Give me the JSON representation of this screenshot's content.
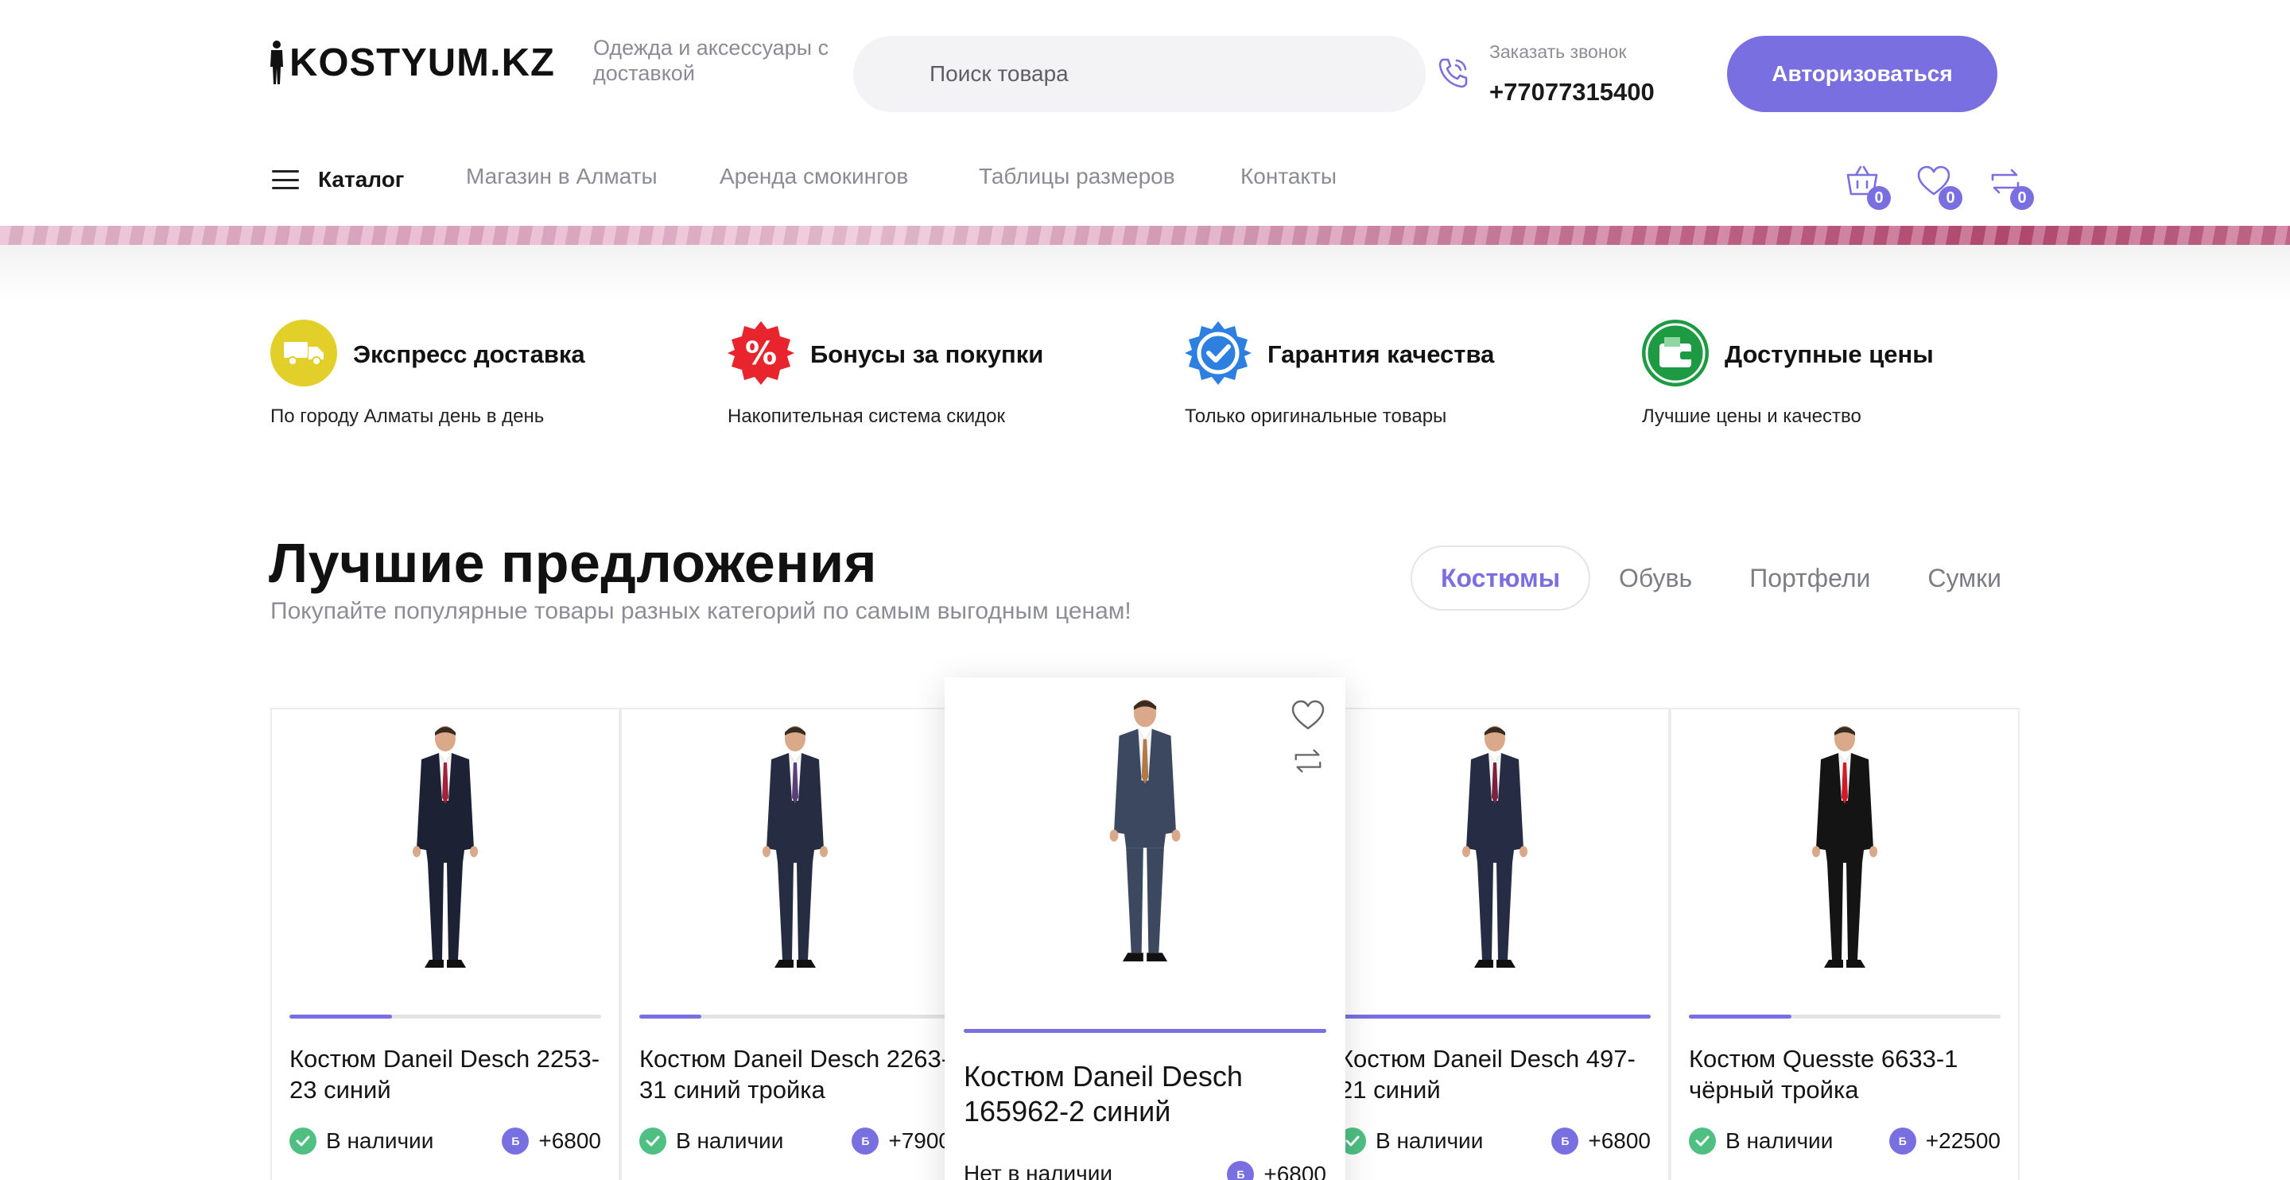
{
  "header": {
    "logo_text": "KOSTYUM.KZ",
    "tagline": "Одежда и аксессуары с доставкой",
    "search_placeholder": "Поиск товара",
    "callback_label": "Заказать звонок",
    "phone": "+77077315400",
    "login_label": "Авторизоваться"
  },
  "nav": {
    "catalog_label": "Каталог",
    "links": [
      "Магазин в Алматы",
      "Аренда смокингов",
      "Таблицы размеров",
      "Контакты"
    ],
    "cart_count": "0",
    "favorites_count": "0",
    "compare_count": "0"
  },
  "features": [
    {
      "title": "Экспресс доставка",
      "desc": "По городу Алматы день в день",
      "icon": "delivery-truck-icon",
      "color": "#e2cf2a"
    },
    {
      "title": "Бонусы за покупки",
      "desc": "Накопительная система скидок",
      "icon": "percent-badge-icon",
      "color": "#e8242c"
    },
    {
      "title": "Гарантия качества",
      "desc": "Только оригинальные товары",
      "icon": "quality-check-icon",
      "color": "#2d7fe0"
    },
    {
      "title": "Доступные цены",
      "desc": "Лучшие цены и качество",
      "icon": "wallet-icon",
      "color": "#1e9a43"
    }
  ],
  "offers": {
    "title": "Лучшие предложения",
    "subtitle": "Покупайте популярные товары разных категорий по самым выгодным ценам!",
    "tabs": [
      "Костюмы",
      "Обувь",
      "Портфели",
      "Сумки"
    ],
    "active_tab": "Костюмы"
  },
  "bonus_badge_letter": "Б",
  "products": [
    {
      "name": "Костюм Daneil Desch 2253-23 синий",
      "stock": "В наличии",
      "bonus": "+6800",
      "in_stock": true,
      "suit_color": "#1c2233",
      "tie_color": "#a3223a",
      "image_progress": 0.33
    },
    {
      "name": "Костюм Daneil Desch 2263-31 синий тройка",
      "stock": "В наличии",
      "bonus": "+7900",
      "in_stock": true,
      "suit_color": "#262d42",
      "tie_color": "#5a3f7a",
      "image_progress": 0.2
    },
    {
      "name": "Костюм Daneil Desch 165962-2 синий",
      "stock": "Нет в наличии",
      "bonus": "+6800",
      "in_stock": false,
      "suit_color": "#3c4860",
      "tie_color": "#b07a4a",
      "image_progress": 1.0
    },
    {
      "name": "Костюм Daneil Desch 497-21 синий",
      "stock": "В наличии",
      "bonus": "+6800",
      "in_stock": true,
      "suit_color": "#252c44",
      "tie_color": "#7a2240",
      "image_progress": 1.0
    },
    {
      "name": "Костюм Quesste 6633-1 чёрный тройка",
      "stock": "В наличии",
      "bonus": "+22500",
      "in_stock": true,
      "suit_color": "#141414",
      "tie_color": "#d01c2a",
      "image_progress": 0.33
    }
  ]
}
